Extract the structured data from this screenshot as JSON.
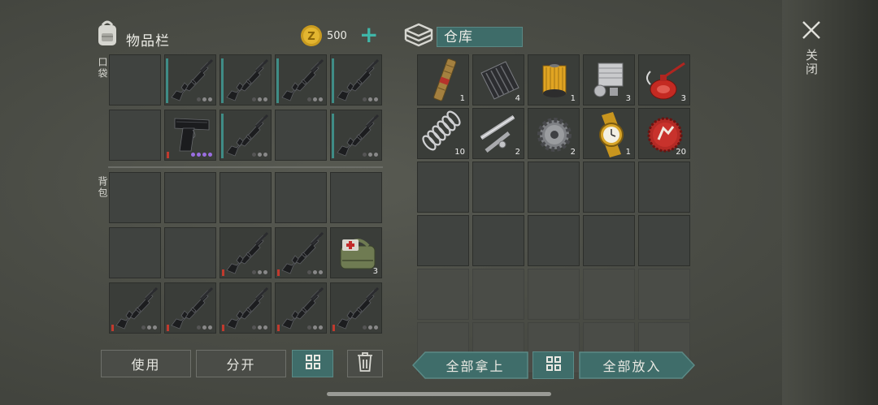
{
  "inventory": {
    "title": "物品栏",
    "pocket_label": "口袋",
    "backpack_label": "背包",
    "coins": "500",
    "add_coins_symbol": "+",
    "pocket_slots": [
      {
        "item": "",
        "count": "",
        "dots": []
      },
      {
        "item": "rifle",
        "count": "",
        "dots": [
          "d",
          "g",
          "g"
        ],
        "teal": true
      },
      {
        "item": "rifle",
        "count": "",
        "dots": [
          "d",
          "g",
          "g"
        ],
        "teal": true
      },
      {
        "item": "rifle",
        "count": "",
        "dots": [
          "d",
          "g",
          "g"
        ],
        "teal": true
      },
      {
        "item": "rifle",
        "count": "",
        "dots": [
          "d",
          "g",
          "g"
        ],
        "teal": true
      },
      {
        "item": "",
        "count": "",
        "dots": []
      },
      {
        "item": "pistol",
        "count": "",
        "dots": [
          "p",
          "p",
          "p",
          "p"
        ],
        "red": true
      },
      {
        "item": "rifle",
        "count": "",
        "dots": [
          "d",
          "g",
          "g"
        ],
        "teal": true
      },
      {
        "item": "",
        "count": "",
        "dots": []
      },
      {
        "item": "rifle",
        "count": "",
        "dots": [
          "d",
          "g",
          "g"
        ],
        "teal": true
      }
    ],
    "backpack_slots": [
      {
        "item": "",
        "count": "",
        "dots": []
      },
      {
        "item": "",
        "count": "",
        "dots": []
      },
      {
        "item": "",
        "count": "",
        "dots": []
      },
      {
        "item": "",
        "count": "",
        "dots": []
      },
      {
        "item": "",
        "count": "",
        "dots": []
      },
      {
        "item": "",
        "count": "",
        "dots": []
      },
      {
        "item": "",
        "count": "",
        "dots": []
      },
      {
        "item": "rifle",
        "count": "",
        "dots": [
          "d",
          "g",
          "g"
        ],
        "red": true
      },
      {
        "item": "rifle",
        "count": "",
        "dots": [
          "d",
          "g",
          "g"
        ],
        "red": true
      },
      {
        "item": "medkit",
        "count": "3",
        "dots": []
      },
      {
        "item": "rifle",
        "count": "",
        "dots": [
          "d",
          "g",
          "g"
        ],
        "red": true
      },
      {
        "item": "rifle",
        "count": "",
        "dots": [
          "d",
          "g",
          "g"
        ],
        "red": true
      },
      {
        "item": "rifle",
        "count": "",
        "dots": [
          "d",
          "g",
          "g"
        ],
        "red": true
      },
      {
        "item": "rifle",
        "count": "",
        "dots": [
          "d",
          "g",
          "g"
        ],
        "red": true
      },
      {
        "item": "rifle",
        "count": "",
        "dots": [
          "d",
          "g",
          "g"
        ],
        "red": true
      }
    ],
    "use_label": "使用",
    "split_label": "分开"
  },
  "storage": {
    "title": "仓库",
    "slots": [
      {
        "item": "ammo-clip",
        "count": "1"
      },
      {
        "item": "metal-sheet",
        "count": "4"
      },
      {
        "item": "oil-filter",
        "count": "1"
      },
      {
        "item": "engine-part",
        "count": "3"
      },
      {
        "item": "oil-can",
        "count": "3"
      },
      {
        "item": "spring",
        "count": "10"
      },
      {
        "item": "rod-parts",
        "count": "2"
      },
      {
        "item": "gear",
        "count": "2"
      },
      {
        "item": "gold-watch",
        "count": "1"
      },
      {
        "item": "bottle-cap",
        "count": "20"
      }
    ],
    "take_all_label": "全部拿上",
    "put_all_label": "全部放入"
  },
  "close_label": "关闭"
}
